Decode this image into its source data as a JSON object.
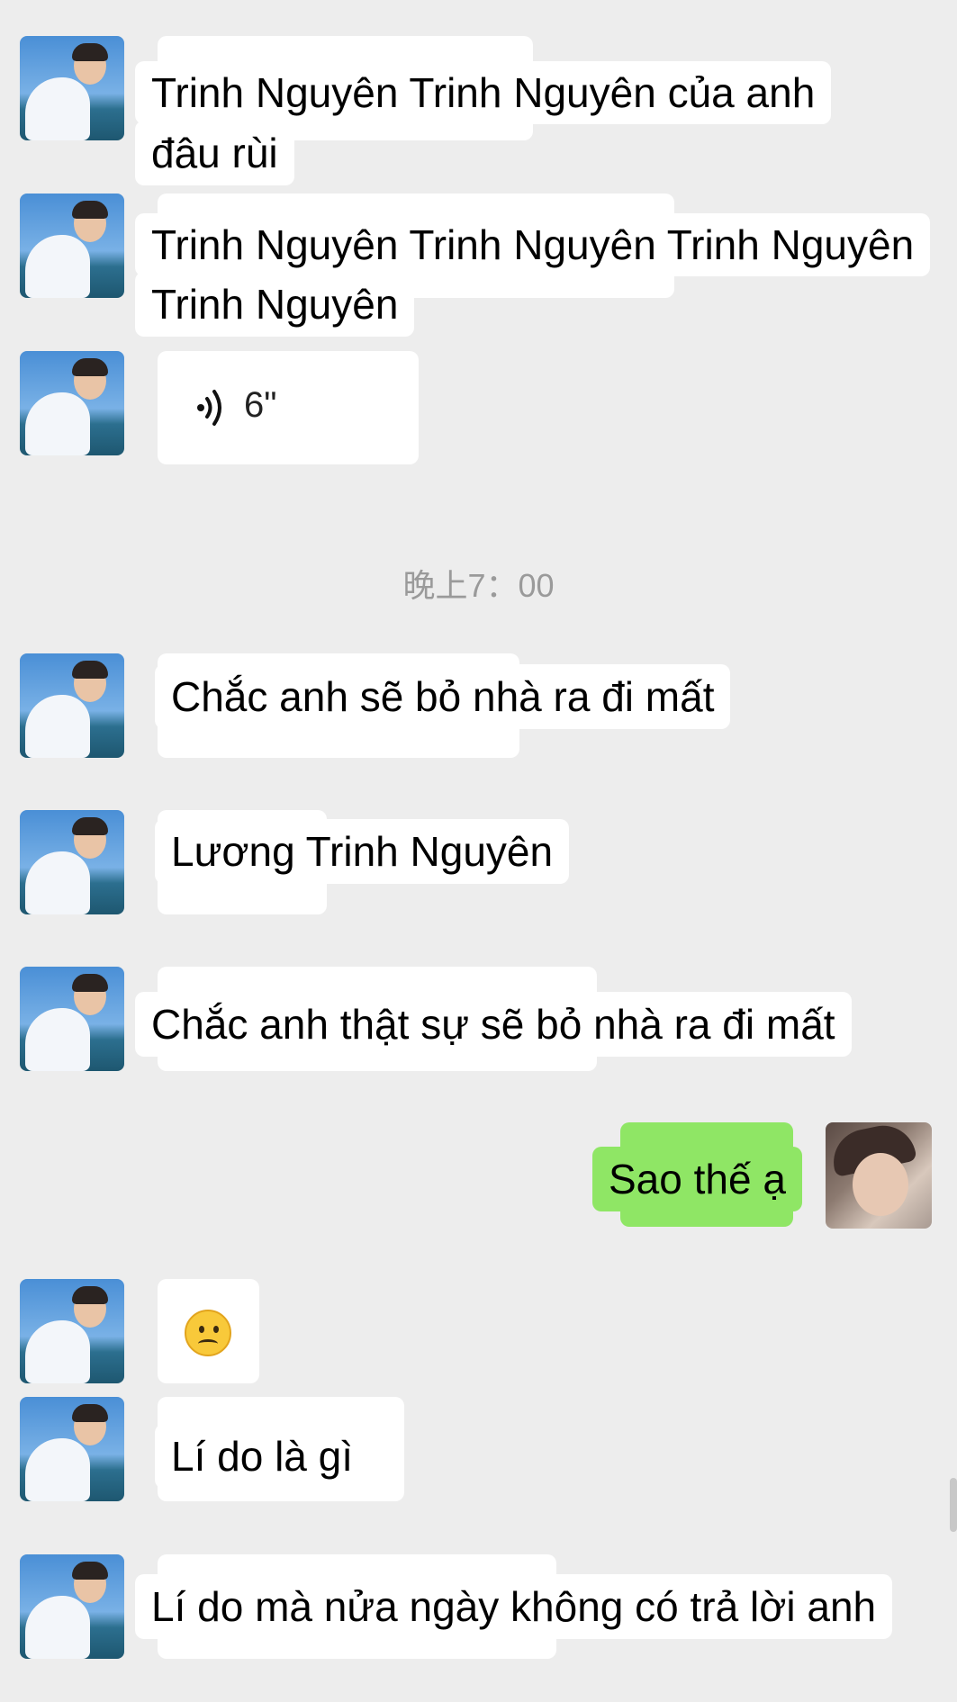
{
  "messages": [
    {
      "line1": "Trinh Nguyên Trinh Nguyên của anh",
      "line2": "đâu rùi"
    },
    {
      "line1": "Trinh Nguyên Trinh Nguyên Trinh Nguyên",
      "line2": "Trinh Nguyên"
    },
    {
      "voice_duration": "6\""
    },
    {
      "timestamp": "晚上7：00"
    },
    {
      "text": "Chắc anh sẽ bỏ nhà ra đi mất"
    },
    {
      "text": "Lương Trinh Nguyên"
    },
    {
      "text": "Chắc anh thật sự sẽ bỏ nhà ra đi mất"
    },
    {
      "text": "Sao thế ạ"
    },
    {
      "emoji": "sad-face"
    },
    {
      "text": "Lí do là gì"
    },
    {
      "text": "Lí do mà nửa ngày không có trả lời anh"
    }
  ],
  "colors": {
    "background": "#ededed",
    "incoming_bubble": "#ffffff",
    "outgoing_bubble": "#8fe665",
    "timestamp": "#9a9a9a"
  }
}
